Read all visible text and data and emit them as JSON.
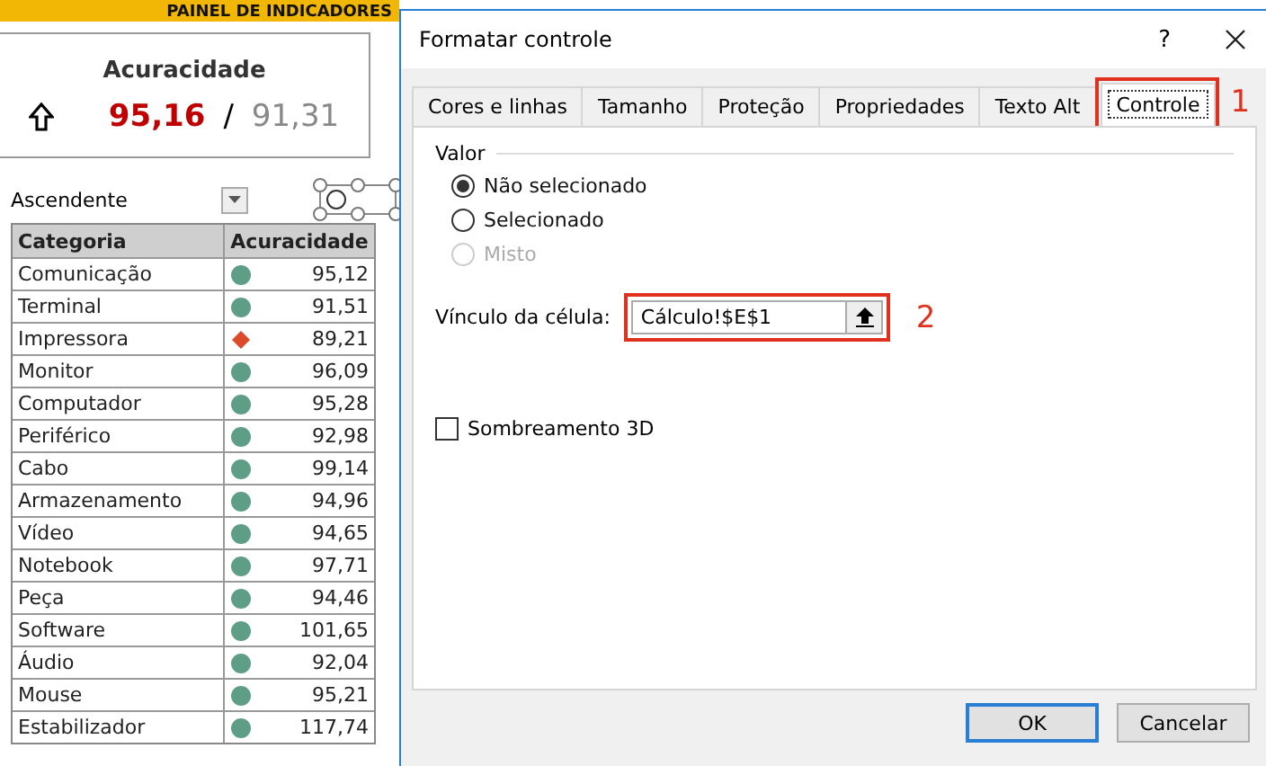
{
  "banner": {
    "title": "PAINEL DE INDICADORES"
  },
  "kpi": {
    "title": "Acuracidade",
    "rising": true,
    "current": "95,16",
    "separator": "/",
    "target": "91,31"
  },
  "sort": {
    "value": "Ascendente"
  },
  "table": {
    "columns": [
      "Categoria",
      "Acuracidade"
    ],
    "rows": [
      {
        "category": "Comunicação",
        "kind": "circle",
        "color": "#5e9e86",
        "value": "95,12"
      },
      {
        "category": "Terminal",
        "kind": "circle",
        "color": "#5e9e86",
        "value": "91,51"
      },
      {
        "category": "Impressora",
        "kind": "diamond",
        "color": "#dc4a2c",
        "value": "89,21"
      },
      {
        "category": "Monitor",
        "kind": "circle",
        "color": "#5e9e86",
        "value": "96,09"
      },
      {
        "category": "Computador",
        "kind": "circle",
        "color": "#5e9e86",
        "value": "95,28"
      },
      {
        "category": "Periférico",
        "kind": "circle",
        "color": "#5e9e86",
        "value": "92,98"
      },
      {
        "category": "Cabo",
        "kind": "circle",
        "color": "#5e9e86",
        "value": "99,14"
      },
      {
        "category": "Armazenamento",
        "kind": "circle",
        "color": "#5e9e86",
        "value": "94,96"
      },
      {
        "category": "Vídeo",
        "kind": "circle",
        "color": "#5e9e86",
        "value": "94,65"
      },
      {
        "category": "Notebook",
        "kind": "circle",
        "color": "#5e9e86",
        "value": "97,71"
      },
      {
        "category": "Peça",
        "kind": "circle",
        "color": "#5e9e86",
        "value": "94,46"
      },
      {
        "category": "Software",
        "kind": "circle",
        "color": "#5e9e86",
        "value": "101,65"
      },
      {
        "category": "Áudio",
        "kind": "circle",
        "color": "#5e9e86",
        "value": "92,04"
      },
      {
        "category": "Mouse",
        "kind": "circle",
        "color": "#5e9e86",
        "value": "95,21"
      },
      {
        "category": "Estabilizador",
        "kind": "circle",
        "color": "#5e9e86",
        "value": "117,74"
      }
    ]
  },
  "dialog": {
    "title": "Formatar controle",
    "help": "?",
    "tabs": [
      {
        "label": "Cores e linhas",
        "selected": false
      },
      {
        "label": "Tamanho",
        "selected": false
      },
      {
        "label": "Proteção",
        "selected": false
      },
      {
        "label": "Propriedades",
        "selected": false
      },
      {
        "label": "Texto Alt",
        "selected": false
      },
      {
        "label": "Controle",
        "selected": true
      }
    ],
    "value_group": "Valor",
    "radios": [
      {
        "label": "Não selecionado",
        "selected": true,
        "disabled": false
      },
      {
        "label": "Selecionado",
        "selected": false,
        "disabled": false
      },
      {
        "label": "Misto",
        "selected": false,
        "disabled": true
      }
    ],
    "cell_link": {
      "label": "Vínculo da célula:",
      "value": "Cálculo!$E$1"
    },
    "shading": {
      "label": "Sombreamento 3D",
      "checked": false
    },
    "buttons": [
      {
        "label": "OK",
        "default": true
      },
      {
        "label": "Cancelar",
        "default": false
      }
    ]
  },
  "annotations": [
    "1",
    "2"
  ]
}
